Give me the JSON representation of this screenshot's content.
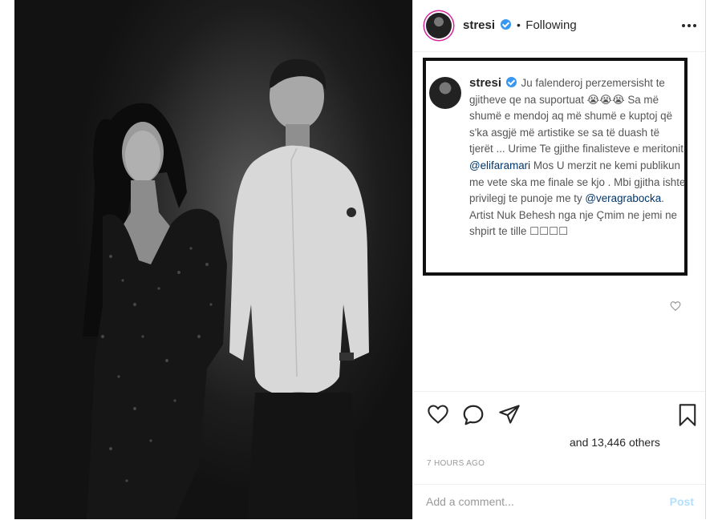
{
  "photo": {
    "alt_icon": "photo-of-couple"
  },
  "header": {
    "username": "stresi",
    "separator": "•",
    "follow_status": "Following",
    "more_icon": "more-dots-icon"
  },
  "caption": {
    "username": "stresi",
    "text_1": "Ju falenderoj perzemersisht te gjitheve qe na suportuat 😭😭😭 Sa më shumë e mendoj aq më shumë e kuptoj që s'ka asgjë më artistike se sa të duash të tjerët ... Urime Te gjithe finalisteve e meritonit",
    "mention_1": "@elifaramari",
    "text_2": "Mos U merzit ne kemi publikun me vete ska me finale se kjo . Mbi gjitha ishte privilegj te punoje me ty",
    "mention_2": "@veragrabocka",
    "text_3": ". Artist Nuk Behesh nga nje Çmim ne jemi ne shpirt te tille ☐☐☐☐"
  },
  "actions": {
    "like_icon": "heart-icon",
    "comment_icon": "comment-bubble-icon",
    "share_icon": "send-icon",
    "save_icon": "bookmark-icon",
    "caption_like_icon": "small-heart-icon"
  },
  "likes_text": "and 13,446 others",
  "timestamp": "7 HOURS AGO",
  "comment": {
    "placeholder": "Add a comment...",
    "post_label": "Post"
  },
  "colors": {
    "verified": "#3897f0",
    "mention": "#003569",
    "post_disabled": "#b2dffc"
  }
}
